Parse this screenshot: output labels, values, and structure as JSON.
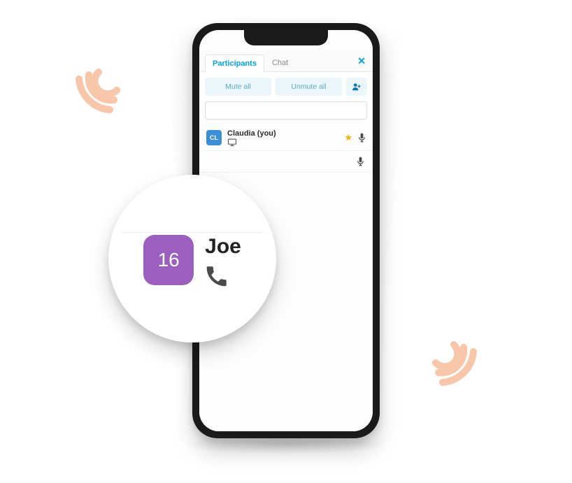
{
  "tabs": {
    "participants": "Participants",
    "chat": "Chat",
    "close": "✕"
  },
  "actions": {
    "mute_all": "Mute all",
    "unmute_all": "Unmute all"
  },
  "search": {
    "placeholder": ""
  },
  "participants": [
    {
      "initials": "CL",
      "name": "Claudia (you)",
      "avatar_color": "#3b8fd6"
    }
  ],
  "callout": {
    "avatar_text": "16",
    "avatar_color": "#9b5fc0",
    "name": "Joe"
  },
  "colors": {
    "accent": "#00a4e4",
    "pill_bg": "#ebf6fb",
    "pill_text": "#5aa9c9",
    "wave": "#f8c6a8"
  }
}
